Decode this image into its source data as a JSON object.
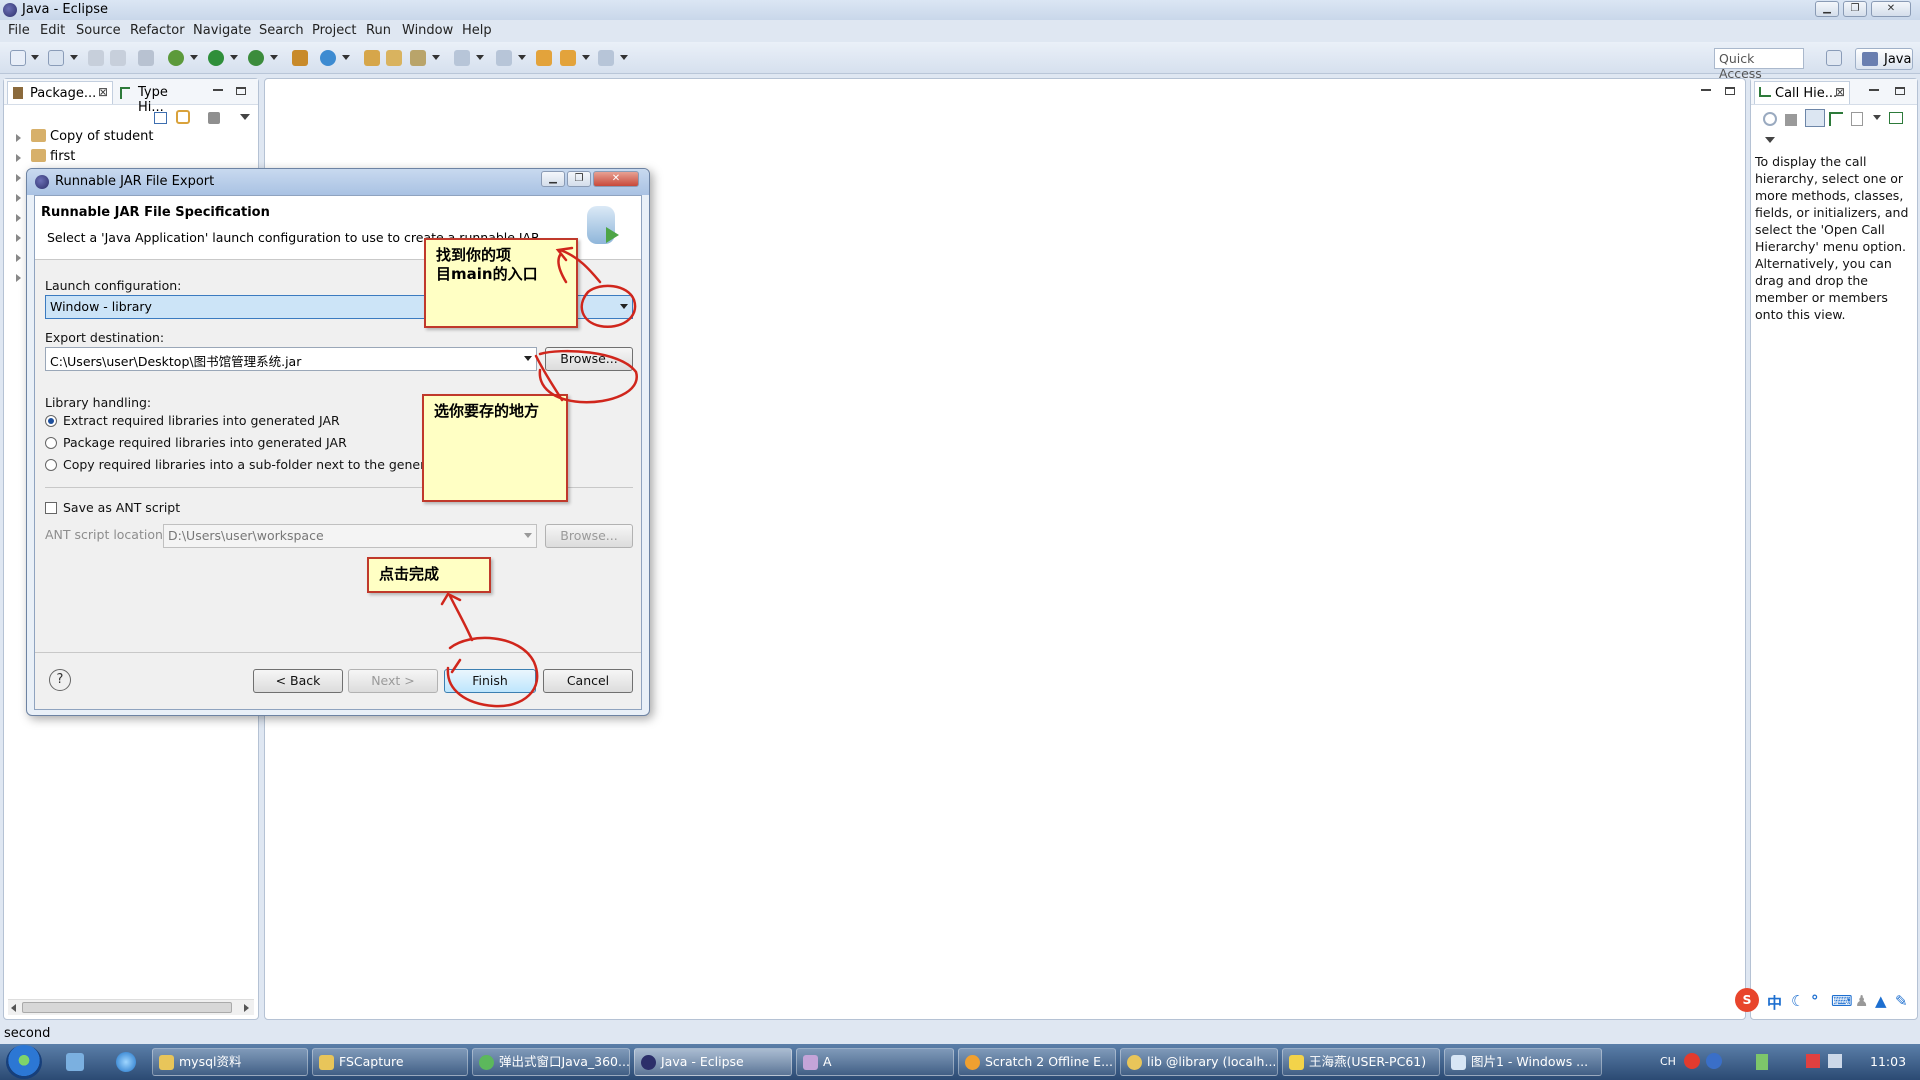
{
  "window": {
    "title": "Java - Eclipse"
  },
  "menu": [
    "File",
    "Edit",
    "Source",
    "Refactor",
    "Navigate",
    "Search",
    "Project",
    "Run",
    "Window",
    "Help"
  ],
  "toolbar": {
    "quick_access": "Quick Access",
    "perspective": "Java"
  },
  "left_panel": {
    "tabs": [
      "Package...",
      "Type Hi..."
    ],
    "tree": [
      "Copy of student",
      "first"
    ]
  },
  "right_panel": {
    "tab": "Call Hie...",
    "help_text": "To display the call hierarchy, select one or more methods, classes, fields, or initializers, and select the 'Open Call Hierarchy' menu option. Alternatively, you can drag and drop the member or members onto this view."
  },
  "dialog": {
    "title": "Runnable JAR File Export",
    "heading": "Runnable JAR File Specification",
    "description": "Select a 'Java Application' launch configuration to use to create a runnable JAR.",
    "launch_label": "Launch configuration:",
    "launch_value": "Window - library",
    "export_label": "Export destination:",
    "export_value": "C:\\Users\\user\\Desktop\\图书馆管理系统.jar",
    "browse": "Browse...",
    "library_label": "Library handling:",
    "options": [
      "Extract required libraries into generated JAR",
      "Package required libraries into generated JAR",
      "Copy required libraries into a sub-folder next to the generated JAR"
    ],
    "selected_option": 0,
    "ant_check": "Save as ANT script",
    "ant_label": "ANT script location:",
    "ant_value": "D:\\Users\\user\\workspace",
    "back": "< Back",
    "next": "Next >",
    "finish": "Finish",
    "cancel": "Cancel"
  },
  "annotations": {
    "main_entry": "找到你的项\n目main的入口",
    "save_place": "选你要存的地方",
    "click_finish": "点击完成"
  },
  "status": {
    "text": "second"
  },
  "taskbar": {
    "items": [
      "mysql资料",
      "FSCapture",
      "弹出式窗口Java_360...",
      "Java - Eclipse",
      "A",
      "Scratch 2 Offline E...",
      "lib @library (localh...",
      "王海燕(USER-PC61)",
      "图片1 - Windows ..."
    ],
    "clock": "11:03",
    "tray_lang": "CH"
  },
  "colors": {
    "note_bg": "#ffffc4",
    "note_border": "#c0392b",
    "selection": "#cce4f7"
  }
}
